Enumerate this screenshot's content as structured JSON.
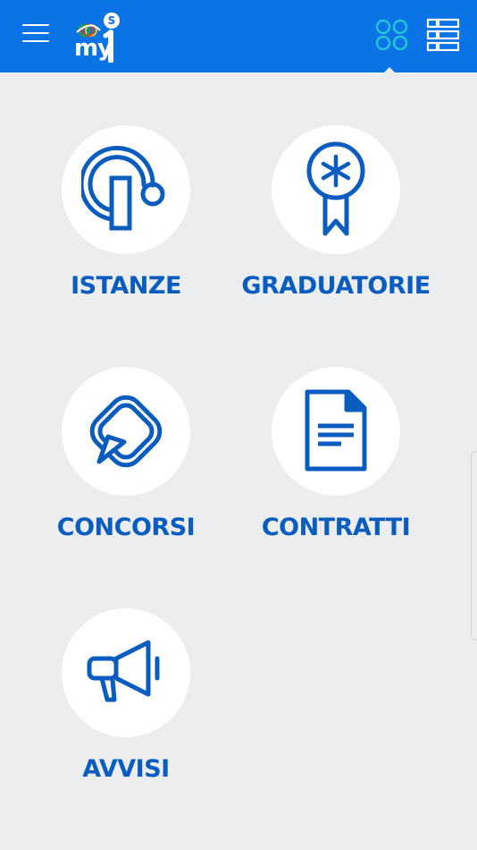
{
  "header": {
    "logo_text": "my",
    "logo_badge": "S"
  },
  "tiles": [
    {
      "id": "istanze",
      "label": "ISTANZE",
      "icon": "istanze-icon"
    },
    {
      "id": "graduatorie",
      "label": "GRADUATORIE",
      "icon": "ribbon-award-icon"
    },
    {
      "id": "concorsi",
      "label": "CONCORSI",
      "icon": "paper-plane-badge-icon"
    },
    {
      "id": "contratti",
      "label": "CONTRATTI",
      "icon": "document-icon"
    },
    {
      "id": "avvisi",
      "label": "AVVISI",
      "icon": "megaphone-icon"
    }
  ],
  "colors": {
    "header_bg": "#0a73e6",
    "accent_teal": "#27c6d4",
    "label_blue": "#0a5dbf",
    "background": "#ebedef"
  }
}
